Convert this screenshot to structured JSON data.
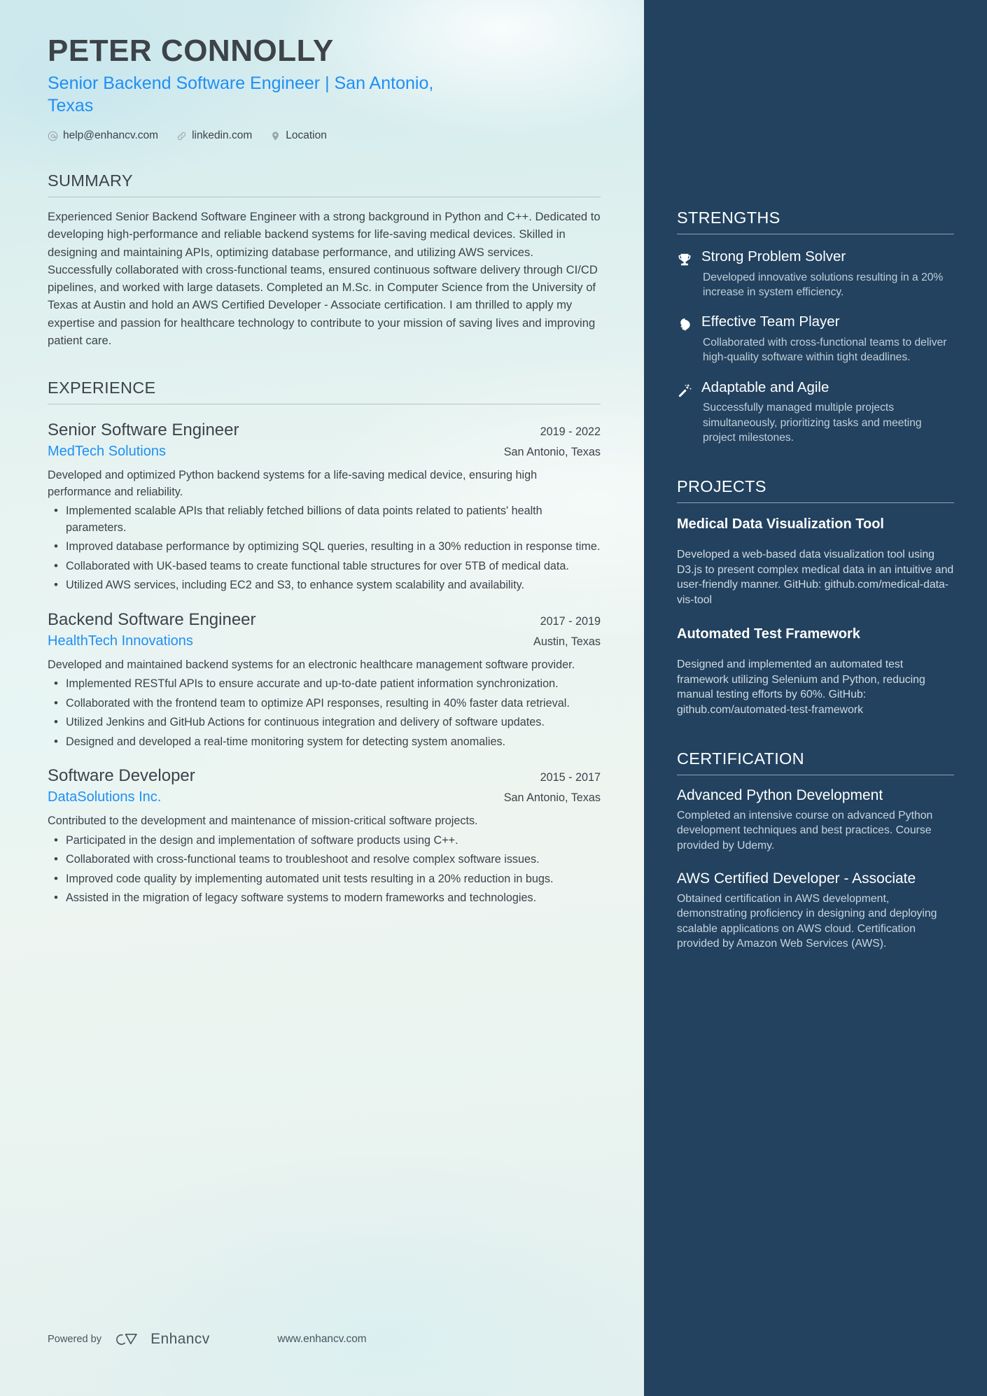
{
  "header": {
    "name": "PETER CONNOLLY",
    "headline": "Senior Backend Software Engineer | San Antonio, Texas",
    "contacts": [
      {
        "icon": "email-icon",
        "text": "help@enhancv.com"
      },
      {
        "icon": "link-icon",
        "text": "linkedin.com"
      },
      {
        "icon": "location-pin-icon",
        "text": "Location"
      }
    ]
  },
  "summary": {
    "title": "SUMMARY",
    "text": "Experienced Senior Backend Software Engineer with a strong background in Python and C++. Dedicated to developing high-performance and reliable backend systems for life-saving medical devices. Skilled in designing and maintaining APIs, optimizing database performance, and utilizing AWS services. Successfully collaborated with cross-functional teams, ensured continuous software delivery through CI/CD pipelines, and worked with large datasets. Completed an M.Sc. in Computer Science from the University of Texas at Austin and hold an AWS Certified Developer - Associate certification. I am thrilled to apply my expertise and passion for healthcare technology to contribute to your mission of saving lives and improving patient care."
  },
  "experience": {
    "title": "EXPERIENCE",
    "jobs": [
      {
        "title": "Senior Software Engineer",
        "dates": "2019 - 2022",
        "company": "MedTech Solutions",
        "location": "San Antonio, Texas",
        "description": "Developed and optimized Python backend systems for a life-saving medical device, ensuring high performance and reliability.",
        "bullets": [
          "Implemented scalable APIs that reliably fetched billions of data points related to patients' health parameters.",
          "Improved database performance by optimizing SQL queries, resulting in a 30% reduction in response time.",
          "Collaborated with UK-based teams to create functional table structures for over 5TB of medical data.",
          "Utilized AWS services, including EC2 and S3, to enhance system scalability and availability."
        ]
      },
      {
        "title": "Backend Software Engineer",
        "dates": "2017 - 2019",
        "company": "HealthTech Innovations",
        "location": "Austin, Texas",
        "description": "Developed and maintained backend systems for an electronic healthcare management software provider.",
        "bullets": [
          "Implemented RESTful APIs to ensure accurate and up-to-date patient information synchronization.",
          "Collaborated with the frontend team to optimize API responses, resulting in 40% faster data retrieval.",
          "Utilized Jenkins and GitHub Actions for continuous integration and delivery of software updates.",
          "Designed and developed a real-time monitoring system for detecting system anomalies."
        ]
      },
      {
        "title": "Software Developer",
        "dates": "2015 - 2017",
        "company": "DataSolutions Inc.",
        "location": "San Antonio, Texas",
        "description": "Contributed to the development and maintenance of mission-critical software projects.",
        "bullets": [
          "Participated in the design and implementation of software products using C++.",
          "Collaborated with cross-functional teams to troubleshoot and resolve complex software issues.",
          "Improved code quality by implementing automated unit tests resulting in a 20% reduction in bugs.",
          "Assisted in the migration of legacy software systems to modern frameworks and technologies."
        ]
      }
    ]
  },
  "strengths": {
    "title": "STRENGTHS",
    "items": [
      {
        "icon": "trophy-icon",
        "name": "Strong Problem Solver",
        "description": "Developed innovative solutions resulting in a 20% increase in system efficiency."
      },
      {
        "icon": "head-brain-icon",
        "name": "Effective Team Player",
        "description": "Collaborated with cross-functional teams to deliver high-quality software within tight deadlines."
      },
      {
        "icon": "magic-wand-icon",
        "name": "Adaptable and Agile",
        "description": "Successfully managed multiple projects simultaneously, prioritizing tasks and meeting project milestones."
      }
    ]
  },
  "projects": {
    "title": "PROJECTS",
    "items": [
      {
        "name": "Medical Data Visualization Tool",
        "description": "Developed a web-based data visualization tool using D3.js to present complex medical data in an intuitive and user-friendly manner. GitHub: github.com/medical-data-vis-tool"
      },
      {
        "name": "Automated Test Framework",
        "description": "Designed and implemented an automated test framework utilizing Selenium and Python, reducing manual testing efforts by 60%. GitHub: github.com/automated-test-framework"
      }
    ]
  },
  "certification": {
    "title": "CERTIFICATION",
    "items": [
      {
        "name": "Advanced Python Development",
        "description": "Completed an intensive course on advanced Python development techniques and best practices. Course provided by Udemy."
      },
      {
        "name": "AWS Certified Developer - Associate",
        "description": "Obtained certification in AWS development, demonstrating proficiency in designing and deploying scalable applications on AWS cloud. Certification provided by Amazon Web Services (AWS)."
      }
    ]
  },
  "footer": {
    "powered_by": "Powered by",
    "brand": "Enhancv",
    "url": "www.enhancv.com"
  },
  "colors": {
    "accent_blue": "#1f8ff5",
    "dark_panel": "#22425f",
    "text_dark": "#3d4349",
    "page_bg": "#e6f2f2"
  }
}
